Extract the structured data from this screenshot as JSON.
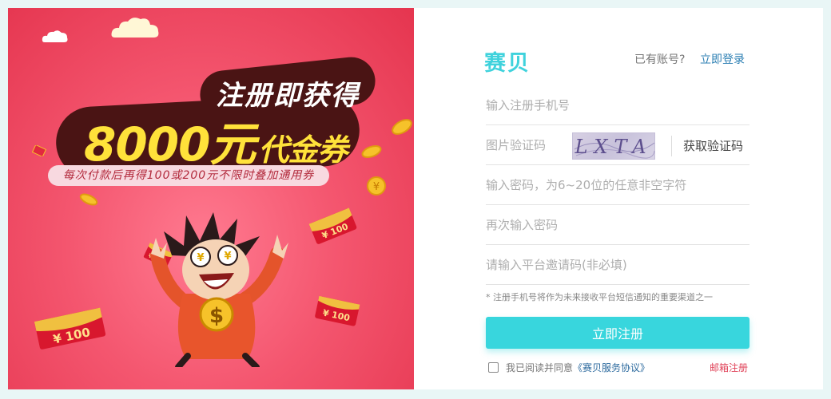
{
  "banner": {
    "headline": "注册即获得",
    "amount": "8000元",
    "amount_suffix": "代金券",
    "ribbon": "每次付款后再得100或200元不限时叠加通用券",
    "envelope_label": "¥ 100",
    "coin_symbol": "¥",
    "mascot_symbol": "$"
  },
  "form": {
    "brand": "赛贝",
    "have_account": "已有账号?",
    "login_link": "立即登录",
    "phone_placeholder": "输入注册手机号",
    "captcha_placeholder": "图片验证码",
    "captcha_text": "LXTA",
    "get_code_label": "获取验证码",
    "password_placeholder": "输入密码，为6~20位的任意非空字符",
    "password_confirm_placeholder": "再次输入密码",
    "invite_placeholder": "请输入平台邀请码(非必填)",
    "note": "* 注册手机号将作为未来接收平台短信通知的重要渠道之一",
    "submit_label": "立即注册",
    "agree_text": "我已阅读并同意",
    "agreement_link": "《赛贝服务协议》",
    "email_register": "邮箱注册"
  },
  "colors": {
    "accent": "#38d6dd",
    "banner": "#f4566f",
    "link": "#2c7fb3",
    "warning": "#e0445a"
  }
}
